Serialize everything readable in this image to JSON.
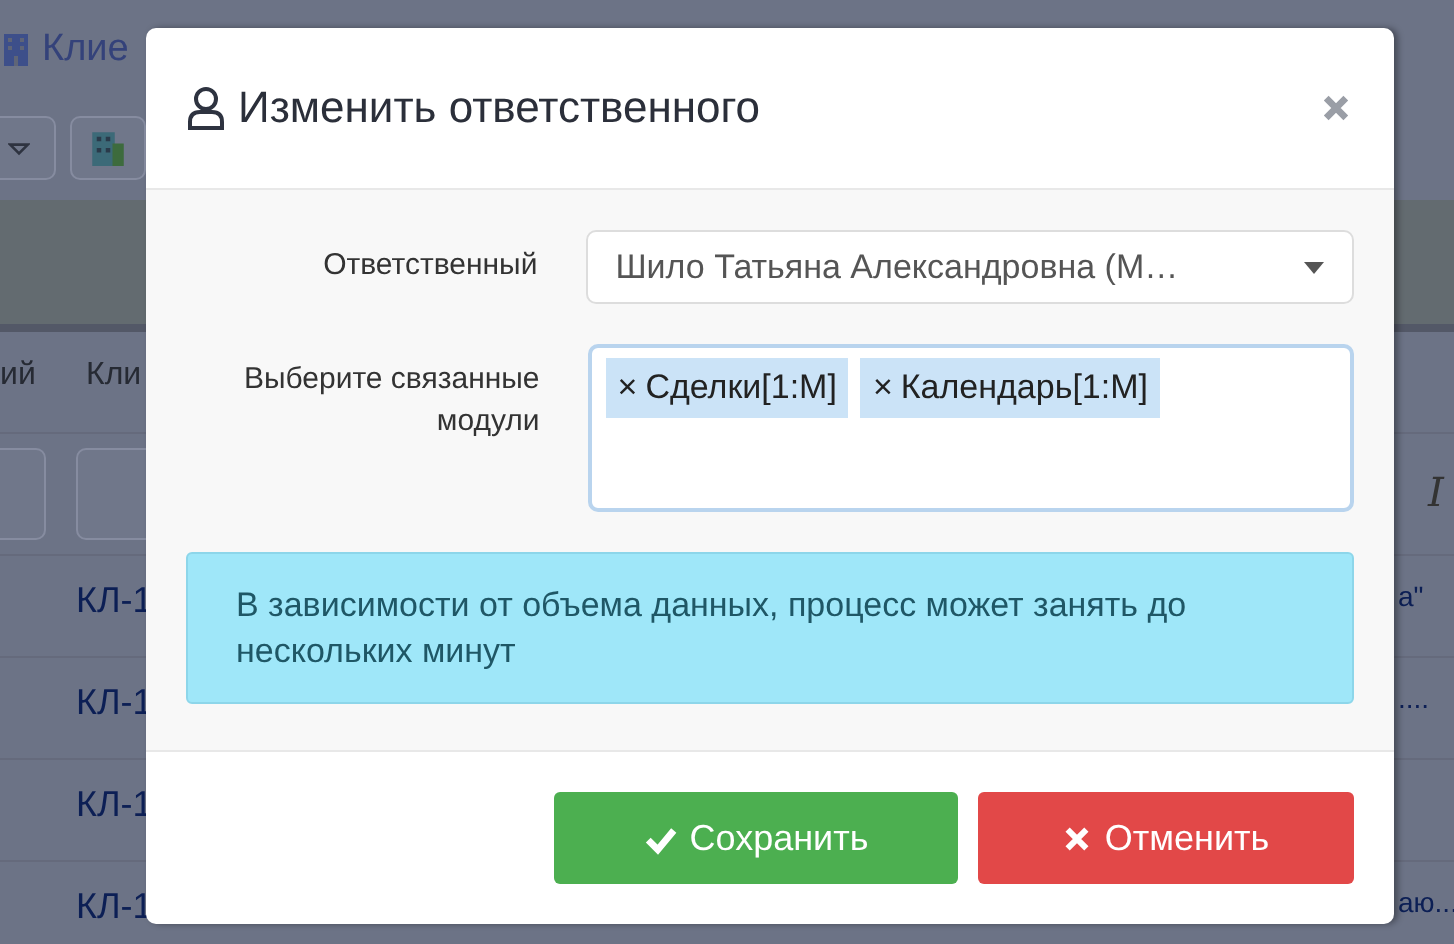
{
  "background_page": {
    "title": "Клие",
    "header_cells": [
      "ий",
      "Кли"
    ],
    "filter_tail": "I",
    "rows": [
      {
        "id": "КЛ-1",
        "tail": "а\""
      },
      {
        "id": "КЛ-1",
        "tail": "...."
      },
      {
        "id": "КЛ-1"
      },
      {
        "id": "КЛ-1",
        "tail": "аю..."
      }
    ]
  },
  "dialog": {
    "title": "Изменить ответственного",
    "fields": [
      {
        "kind": "select",
        "label": "Ответственный",
        "value": "Шило Татьяна Александровна (М…"
      },
      {
        "kind": "tags",
        "label": "Выберите связанные модули",
        "tags": [
          {
            "remove": "×",
            "label": "Сделки[1:М]"
          },
          {
            "remove": "×",
            "label": "Календарь[1:М]"
          }
        ]
      }
    ],
    "notice": "В зависимости от объема данных, процесс может занять до нескольких минут",
    "buttons": [
      {
        "kind": "save",
        "label": "Сохранить"
      },
      {
        "kind": "cancel",
        "label": "Отменить"
      }
    ]
  }
}
